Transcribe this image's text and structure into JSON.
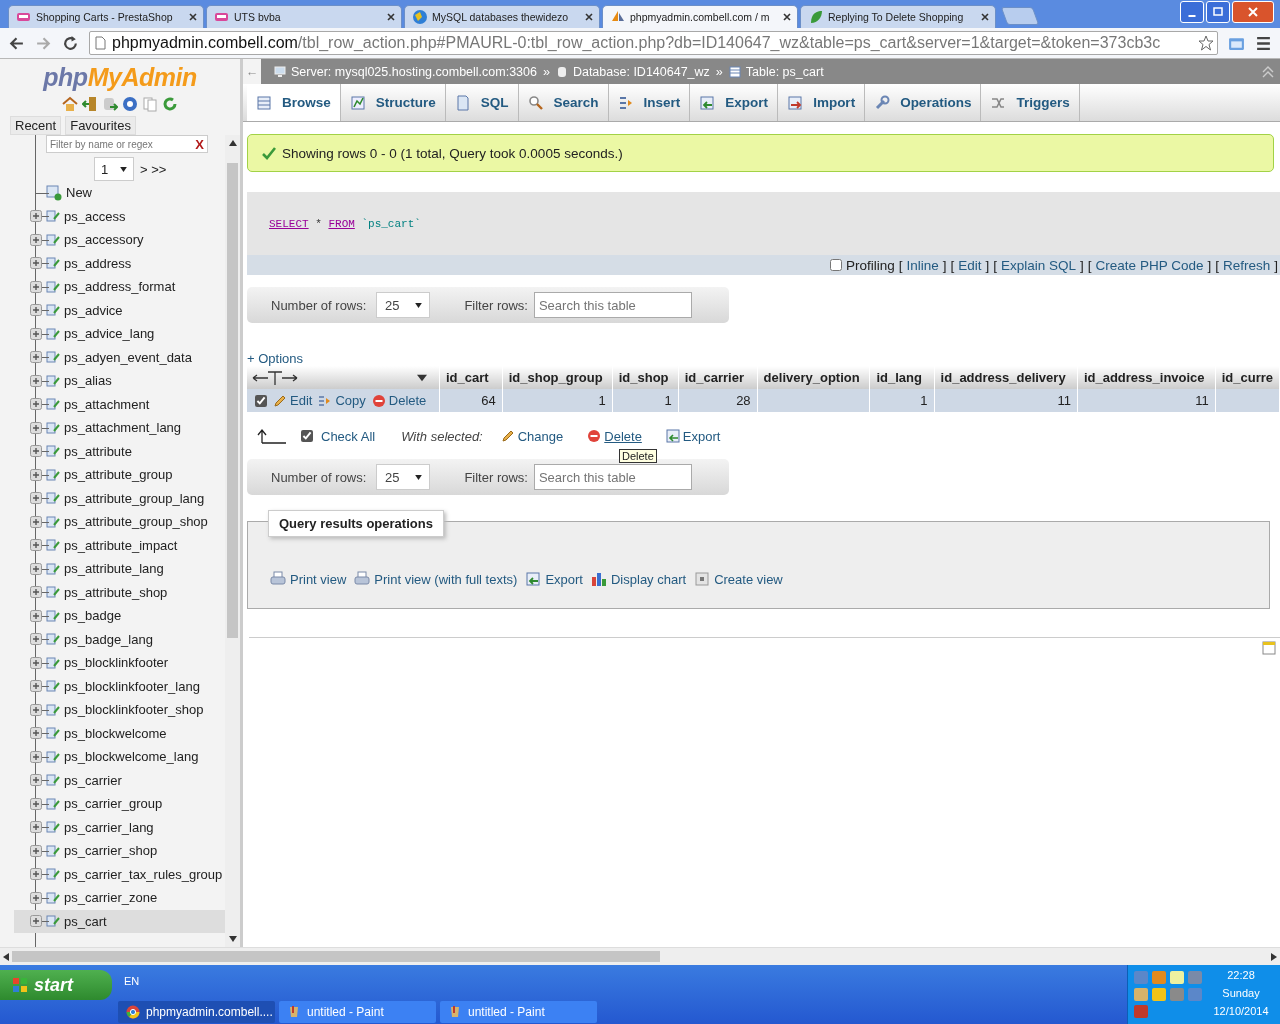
{
  "browser": {
    "tabs": [
      {
        "title": "Shopping Carts - PrestaShop",
        "kind": "presta",
        "selected": false
      },
      {
        "title": "UTS bvba",
        "kind": "presta",
        "selected": false
      },
      {
        "title": "MySQL databases thewidezo",
        "kind": "globe",
        "selected": false
      },
      {
        "title": "phpmyadmin.combell.com / m",
        "kind": "pma",
        "selected": true
      },
      {
        "title": "Replying To Delete Shopping",
        "kind": "leaf",
        "selected": false
      }
    ],
    "url": {
      "host": "phpmyadmin.combell.com",
      "path": "/tbl_row_action.php#PMAURL-0:tbl_row_action.php?db=ID140647_wz&table=ps_cart&server=1&target=&token=373cb3c"
    }
  },
  "sidebar": {
    "logo": {
      "part_1": "php",
      "part_2": "MyAdmin"
    },
    "tabs": [
      {
        "label": "Recent"
      },
      {
        "label": "Favourites"
      }
    ],
    "filter": {
      "placeholder": "Filter by name or regex",
      "clear": "X"
    },
    "page": {
      "value": "1",
      "next": "> >>"
    },
    "tree": [
      {
        "name": "New",
        "kind": "new",
        "selected": false
      },
      {
        "name": "ps_access",
        "kind": "table",
        "selected": false
      },
      {
        "name": "ps_accessory",
        "kind": "table",
        "selected": false
      },
      {
        "name": "ps_address",
        "kind": "table",
        "selected": false
      },
      {
        "name": "ps_address_format",
        "kind": "table",
        "selected": false
      },
      {
        "name": "ps_advice",
        "kind": "table",
        "selected": false
      },
      {
        "name": "ps_advice_lang",
        "kind": "table",
        "selected": false
      },
      {
        "name": "ps_adyen_event_data",
        "kind": "table",
        "selected": false
      },
      {
        "name": "ps_alias",
        "kind": "table",
        "selected": false
      },
      {
        "name": "ps_attachment",
        "kind": "table",
        "selected": false
      },
      {
        "name": "ps_attachment_lang",
        "kind": "table",
        "selected": false
      },
      {
        "name": "ps_attribute",
        "kind": "table",
        "selected": false
      },
      {
        "name": "ps_attribute_group",
        "kind": "table",
        "selected": false
      },
      {
        "name": "ps_attribute_group_lang",
        "kind": "table",
        "selected": false
      },
      {
        "name": "ps_attribute_group_shop",
        "kind": "table",
        "selected": false
      },
      {
        "name": "ps_attribute_impact",
        "kind": "table",
        "selected": false
      },
      {
        "name": "ps_attribute_lang",
        "kind": "table",
        "selected": false
      },
      {
        "name": "ps_attribute_shop",
        "kind": "table",
        "selected": false
      },
      {
        "name": "ps_badge",
        "kind": "table",
        "selected": false
      },
      {
        "name": "ps_badge_lang",
        "kind": "table",
        "selected": false
      },
      {
        "name": "ps_blocklinkfooter",
        "kind": "table",
        "selected": false
      },
      {
        "name": "ps_blocklinkfooter_lang",
        "kind": "table",
        "selected": false
      },
      {
        "name": "ps_blocklinkfooter_shop",
        "kind": "table",
        "selected": false
      },
      {
        "name": "ps_blockwelcome",
        "kind": "table",
        "selected": false
      },
      {
        "name": "ps_blockwelcome_lang",
        "kind": "table",
        "selected": false
      },
      {
        "name": "ps_carrier",
        "kind": "table",
        "selected": false
      },
      {
        "name": "ps_carrier_group",
        "kind": "table",
        "selected": false
      },
      {
        "name": "ps_carrier_lang",
        "kind": "table",
        "selected": false
      },
      {
        "name": "ps_carrier_shop",
        "kind": "table",
        "selected": false
      },
      {
        "name": "ps_carrier_tax_rules_group",
        "kind": "table",
        "selected": false
      },
      {
        "name": "ps_carrier_zone",
        "kind": "table",
        "selected": false
      },
      {
        "name": "ps_cart",
        "kind": "table",
        "selected": true
      }
    ]
  },
  "back_arrow": "←",
  "breadcrumb_separator": "»",
  "breadcrumb": [
    {
      "kind": "server",
      "label": "Server: mysql025.hosting.combell.com:3306"
    },
    {
      "kind": "database",
      "label": "Database: ID140647_wz"
    },
    {
      "kind": "table",
      "label": "Table: ps_cart"
    }
  ],
  "menu_tabs": [
    {
      "label": "Browse",
      "kind": "browse",
      "selected": true
    },
    {
      "label": "Structure",
      "kind": "structure",
      "selected": false
    },
    {
      "label": "SQL",
      "kind": "sql",
      "selected": false
    },
    {
      "label": "Search",
      "kind": "search",
      "selected": false
    },
    {
      "label": "Insert",
      "kind": "insert",
      "selected": false
    },
    {
      "label": "Export",
      "kind": "export",
      "selected": false
    },
    {
      "label": "Import",
      "kind": "import",
      "selected": false
    },
    {
      "label": "Operations",
      "kind": "operations",
      "selected": false
    },
    {
      "label": "Triggers",
      "kind": "triggers",
      "selected": false
    }
  ],
  "message": "Showing rows 0 - 0 (1 total, Query took 0.0005 seconds.)",
  "sql": {
    "query": [
      {
        "kind": "keyword",
        "text": "SELECT"
      },
      {
        "kind": "operator",
        "text": "*"
      },
      {
        "kind": "keyword",
        "text": "FROM"
      },
      {
        "kind": "identifier",
        "text": "`ps_cart`"
      }
    ],
    "profiling": {
      "label": "Profiling",
      "checked": false
    },
    "bracket_open": "[",
    "bracket_close": "]",
    "links": [
      "Inline",
      "Edit",
      "Explain SQL",
      "Create PHP Code",
      "Refresh"
    ]
  },
  "navigation": [
    {
      "rows_label": "Number of rows:",
      "rows_value": "25",
      "filter_label": "Filter rows:",
      "filter_placeholder": "Search this table"
    },
    {
      "rows_label": "Number of rows:",
      "rows_value": "25",
      "filter_label": "Filter rows:",
      "filter_placeholder": "Search this table"
    }
  ],
  "options_link": "+ Options",
  "table": {
    "columns": [
      "id_cart",
      "id_shop_group",
      "id_shop",
      "id_carrier",
      "delivery_option",
      "id_lang",
      "id_address_delivery",
      "id_address_invoice",
      "id_curre"
    ],
    "rows": [
      {
        "checked": true,
        "actions": [
          {
            "label": "Edit",
            "kind": "edit"
          },
          {
            "label": "Copy",
            "kind": "copy"
          },
          {
            "label": "Delete",
            "kind": "delete"
          }
        ],
        "cells": [
          "64",
          "1",
          "1",
          "28",
          null,
          "1",
          "11",
          "11",
          null
        ]
      }
    ]
  },
  "bulk": {
    "check_all": {
      "label": "Check All",
      "checked": true
    },
    "with_selected": "With selected:",
    "actions": [
      {
        "label": "Change",
        "kind": "edit"
      },
      {
        "label": "Delete",
        "kind": "delete"
      },
      {
        "label": "Export",
        "kind": "export"
      }
    ]
  },
  "tooltip": "Delete",
  "query_ops": {
    "legend": "Query results operations",
    "links": [
      {
        "label": "Print view",
        "kind": "print"
      },
      {
        "label": "Print view (with full texts)",
        "kind": "print"
      },
      {
        "label": "Export",
        "kind": "export"
      },
      {
        "label": "Display chart",
        "kind": "chart"
      },
      {
        "label": "Create view",
        "kind": "view"
      }
    ]
  },
  "taskbar": {
    "start": "start",
    "language": "EN",
    "tasks": [
      {
        "label": "phpmyadmin.combell....",
        "kind": "chrome",
        "selected": true
      },
      {
        "label": "untitled - Paint",
        "kind": "paint",
        "selected": false
      },
      {
        "label": "untitled - Paint",
        "kind": "paint",
        "selected": false
      }
    ],
    "clock": {
      "time": "22:28",
      "day": "Sunday",
      "date": "12/10/2014"
    }
  }
}
